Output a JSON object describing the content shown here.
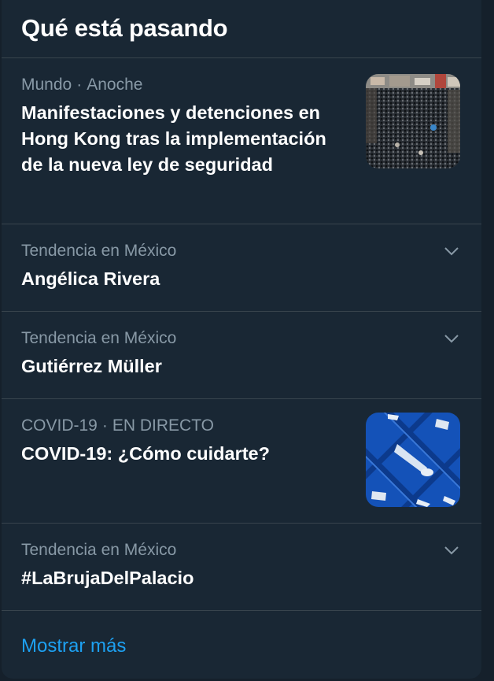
{
  "header": {
    "title": "Qué está pasando"
  },
  "items": [
    {
      "category": "Mundo",
      "time": "Anoche",
      "title": "Manifestaciones y detenciones en Hong Kong tras la implementación de la nueva ley de seguridad",
      "thumbnail": "crowd-photo"
    },
    {
      "category": "Tendencia en México",
      "title": "Angélica Rivera",
      "icon": "chevron-down-icon"
    },
    {
      "category": "Tendencia en México",
      "title": "Gutiérrez Müller",
      "icon": "chevron-down-icon"
    },
    {
      "category": "COVID-19",
      "time": "EN DIRECTO",
      "title": "COVID-19: ¿Cómo cuidarte?",
      "thumbnail": "covid-illustration"
    },
    {
      "category": "Tendencia en México",
      "title": "#LaBrujaDelPalacio",
      "icon": "chevron-down-icon"
    }
  ],
  "footer": {
    "show_more_label": "Mostrar más"
  },
  "colors": {
    "background": "#15202b",
    "panel": "#192734",
    "divider": "#38444d",
    "secondary_text": "#8899a6",
    "link": "#1da1f2"
  }
}
